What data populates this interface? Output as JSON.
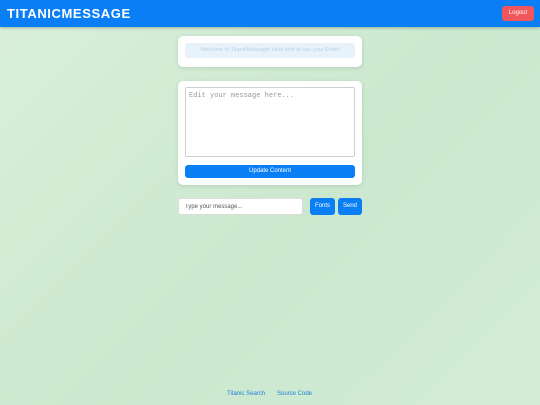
{
  "header": {
    "brand": "TITANICMESSAGE",
    "logout_label": "Logout"
  },
  "welcome": {
    "text": "Welcome to TitanicMessage! Hold shift to use your Enter!"
  },
  "editor": {
    "placeholder": "Edit your message here...",
    "value": "",
    "update_label": "Update Content"
  },
  "composer": {
    "placeholder": "Type your message...",
    "value": "",
    "fonts_label": "Fonts",
    "send_label": "Send"
  },
  "footer": {
    "links": [
      {
        "label": "Titanic Search"
      },
      {
        "label": "Source Code"
      }
    ]
  },
  "colors": {
    "primary": "#0a7ff5",
    "danger": "#f0565b",
    "background": "#d3ecd6"
  }
}
